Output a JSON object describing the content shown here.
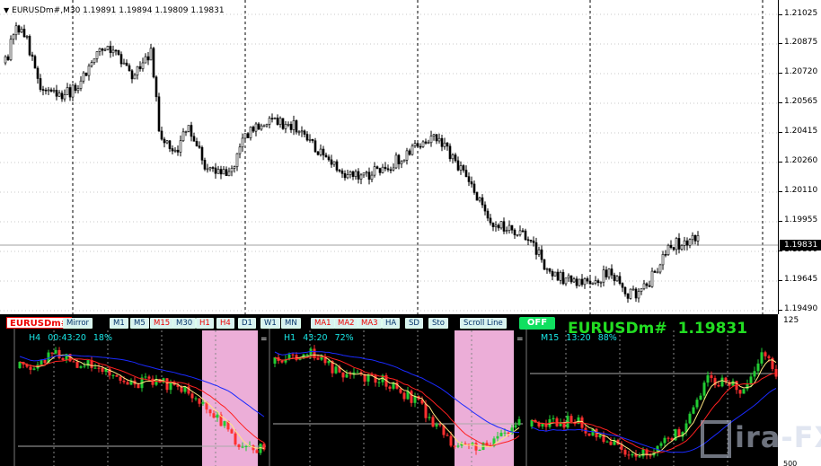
{
  "header": {
    "symbol_line": "EURUSDm#,M30  1.19891 1.19894 1.19809 1.19831"
  },
  "price_scale": {
    "ticks": [
      "1.21025",
      "1.20875",
      "1.20720",
      "1.20565",
      "1.20415",
      "1.20260",
      "1.20110",
      "1.19955",
      "1.19800",
      "1.19645",
      "1.19490"
    ],
    "current_price": "1.19831"
  },
  "main_chart": {
    "type": "candlestick",
    "timeframe": "M30",
    "ylim": [
      1.1949,
      1.2107
    ],
    "current_price": 1.19831
  },
  "toolbar": {
    "symbol": "EURUSDm#",
    "mirror": "Mirror",
    "timeframes": [
      "M1",
      "M5",
      "M15",
      "M30",
      "H1",
      "H4",
      "D1",
      "W1",
      "MN"
    ],
    "indicators": [
      "MA1",
      "MA2",
      "MA3",
      "HA",
      "SD",
      "Sto"
    ],
    "scroll_line": "Scroll Line",
    "off": "OFF"
  },
  "sub_charts": [
    {
      "tf": "H4",
      "timer": "00:43:20",
      "pct": "18%"
    },
    {
      "tf": "H1",
      "timer": "43:20",
      "pct": "72%"
    },
    {
      "tf": "M15",
      "timer": "13:20",
      "pct": "88%"
    }
  ],
  "title": {
    "symbol": "EURUSDm#",
    "price": "1.19831"
  },
  "panel_scale": {
    "top": "125",
    "bottom": "500"
  },
  "watermark": "ira-FX",
  "colors": {
    "bull": "#22cc33",
    "bear": "#ff3030",
    "ma_blue": "#1a2aff",
    "ma_red": "#ff2020",
    "ma_yellow": "#ffe680",
    "highlight": "#ecaed8"
  }
}
